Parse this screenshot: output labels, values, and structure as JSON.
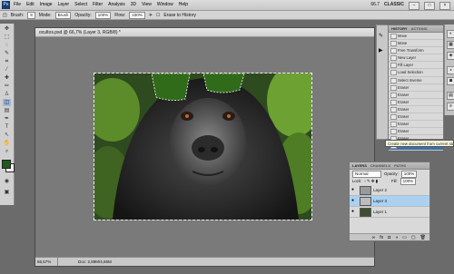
{
  "app": {
    "logo": "Ps",
    "menus": [
      "File",
      "Edit",
      "Image",
      "Layer",
      "Select",
      "Filter",
      "Analysis",
      "3D",
      "View",
      "Window",
      "Help"
    ],
    "zoom": "66.7",
    "workspace": "CLASSIC"
  },
  "options": {
    "brush_label": "Brush:",
    "brush_size": "9",
    "mode_label": "Mode:",
    "mode_value": "Brush",
    "opacity_label": "Opacity:",
    "opacity_value": "100%",
    "flow_label": "Flow:",
    "flow_value": "100%",
    "erase_history": "Erase to History"
  },
  "document": {
    "title": "ocultos.psd @ 66,7% (Layer 3, RGB/8) *",
    "zoom": "66,67%",
    "doc_info": "Doc: 2,89M/4,66M",
    "sunglasses_color": "#2f6b18"
  },
  "history": {
    "tabs": [
      "HISTORY",
      "ACTIONS"
    ],
    "items": [
      "Move",
      "Move",
      "Free Transform",
      "New Layer",
      "Fill Layer",
      "Load Selection",
      "Select Inverse",
      "Eraser",
      "Eraser",
      "Eraser",
      "Eraser",
      "Eraser",
      "Eraser",
      "Eraser",
      "Eraser",
      "Eraser"
    ]
  },
  "tooltip": "Create new document from current state",
  "layers": {
    "tabs": [
      "LAYERS",
      "CHANNELS",
      "PATHS"
    ],
    "blend_mode": "Normal",
    "opacity_label": "Opacity:",
    "opacity": "100%",
    "lock_label": "Lock:",
    "fill_label": "Fill:",
    "fill": "100%",
    "items": [
      {
        "name": "Layer 2",
        "active": false
      },
      {
        "name": "Layer 3",
        "active": true
      },
      {
        "name": "Layer 1",
        "active": false
      }
    ]
  },
  "colors": {
    "foreground": "#1f5a1a",
    "background": "#ffffff"
  }
}
